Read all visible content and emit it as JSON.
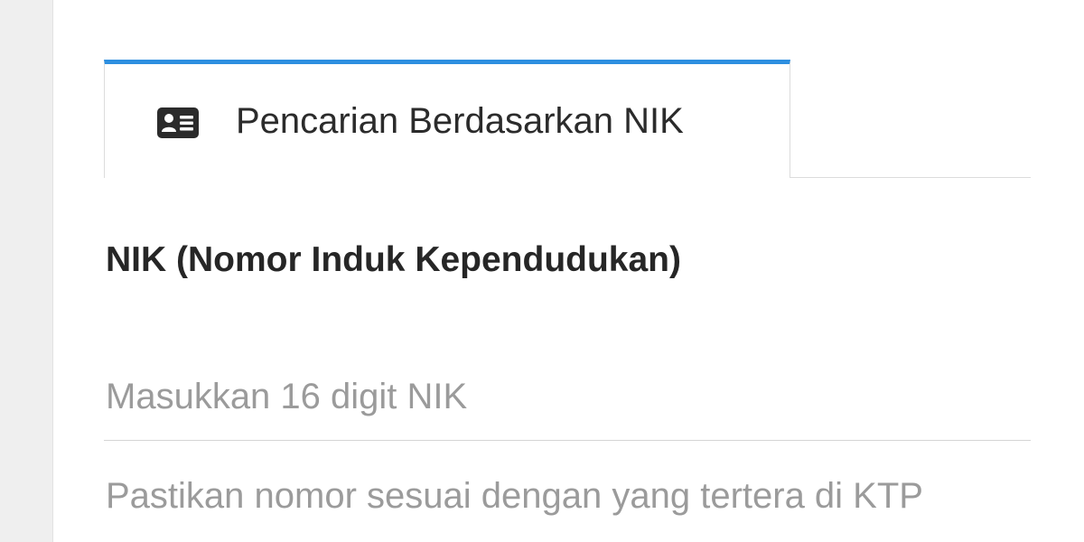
{
  "tabs": [
    {
      "label": "Pencarian Berdasarkan NIK",
      "icon": "id-card-icon",
      "active": true
    }
  ],
  "form": {
    "nik_label": "NIK (Nomor Induk Kependudukan)",
    "nik_value": "",
    "nik_placeholder": "Masukkan 16 digit NIK",
    "helper_text": "Pastikan nomor sesuai dengan yang tertera di KTP"
  },
  "colors": {
    "accent": "#2d8fe0",
    "label_text": "#262626",
    "muted_text": "#9b9b9b",
    "divider": "#d5d5d5"
  }
}
